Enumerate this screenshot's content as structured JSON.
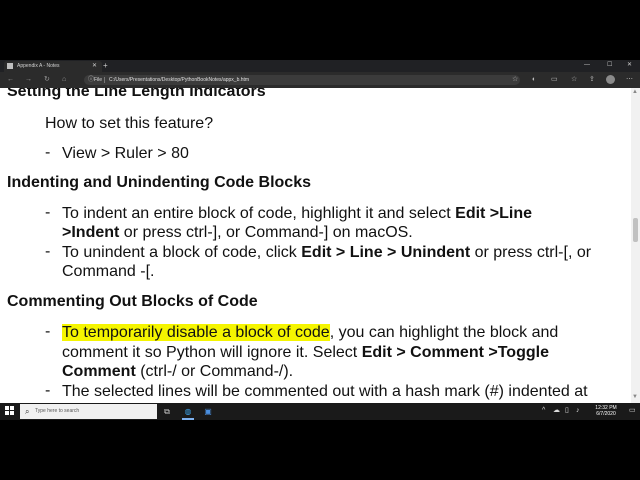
{
  "browser": {
    "tab_title": "Appendix A - Notes",
    "tab_close": "✕",
    "new_tab": "+",
    "window_controls": [
      "—",
      "☐",
      "✕"
    ],
    "nav_icons": [
      "back-icon",
      "forward-icon",
      "refresh-icon",
      "home-icon"
    ],
    "address_scheme_label": "File",
    "url": "C:/Users/Presentations/Desktop/PythonBookNotes/appx_b.htm",
    "toolbar_icons": [
      "favorites-star-icon",
      "reading-icon",
      "collections-icon",
      "favorites-icon",
      "share-icon",
      "profile-avatar",
      "more-icon"
    ]
  },
  "content": {
    "heading1": "Setting the Line Length Indicators",
    "q1": "How to set this feature?",
    "item1": {
      "dash": "-",
      "text": "View > Ruler > 80"
    },
    "heading2": "Indenting and Unindenting Code Blocks",
    "item2": {
      "dash": "-",
      "l1_a": "To indent an entire block of code, highlight it and select ",
      "l1_b": "Edit >Line",
      "l2_a": ">Indent",
      "l2_b": " or press ctrl-], or Command-] on macOS."
    },
    "item3": {
      "dash": "-",
      "l1_a": "To unindent a block of code, click ",
      "l1_b": "Edit > Line > Unindent",
      "l1_c": " or press ctrl-[, or",
      "l2": "Command -[."
    },
    "heading3": "Commenting Out Blocks of Code",
    "item4": {
      "dash": "-",
      "l1_hl": "To temporarily disable a block of code",
      "l1_b": ", you can highlight the block and",
      "l2_a": "comment it so Python will ignore it. Select ",
      "l2_b": "Edit > Comment >Toggle",
      "l3_a": "Comment",
      "l3_b": " (ctrl-/ or Command-/)."
    },
    "item5": {
      "dash": "-",
      "l1": "The selected lines will be commented out with a hash mark (#) indented at"
    }
  },
  "taskbar": {
    "search_placeholder": "Type here to search",
    "clock_time": "12:32 PM",
    "clock_date": "6/7/2020",
    "highlight_color": "#f5f500"
  }
}
